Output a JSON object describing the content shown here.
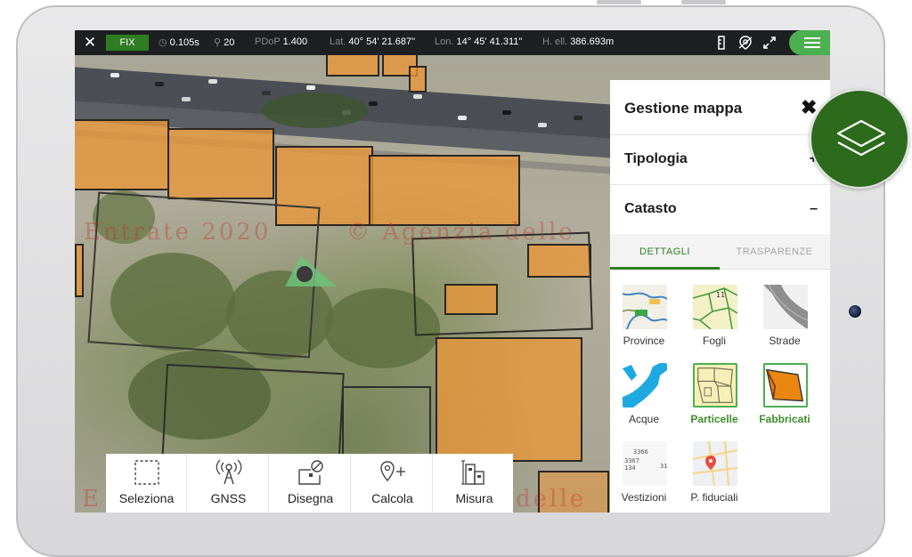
{
  "statusbar": {
    "fix_label": "FIX",
    "latency": "0.105s",
    "satellites": "20",
    "pdop_label": "PDoP",
    "pdop_value": "1.400",
    "lat_label": "Lat.",
    "lat_value": "40° 54' 21.687\"",
    "lon_label": "Lon.",
    "lon_value": "14° 45' 41.311\"",
    "hell_label": "H. ell.",
    "hell_value": "386.693m"
  },
  "map": {
    "watermark_1": "Entrate 2020",
    "watermark_2": "© Agenzia delle",
    "watermark_3": "E",
    "watermark_4": "delle"
  },
  "panel": {
    "title": "Gestione mappa",
    "close_icon": "close-icon",
    "sections": [
      {
        "label": "Tipologia",
        "sign": "+"
      },
      {
        "label": "Catasto",
        "sign": "–"
      }
    ],
    "tabs": [
      {
        "label": "DETTAGLI"
      },
      {
        "label": "TRASPARENZE"
      }
    ],
    "layers": [
      {
        "label": "Province"
      },
      {
        "label": "Fogli"
      },
      {
        "label": "Strade"
      },
      {
        "label": "Acque"
      },
      {
        "label": "Particelle"
      },
      {
        "label": "Fabbricati"
      },
      {
        "label": "Vestizioni"
      },
      {
        "label": "P. fiduciali"
      }
    ],
    "fogli_thumb_number": "11",
    "vestizioni_thumb_text": [
      "3366",
      "3367",
      "134",
      "31"
    ]
  },
  "toolbar": {
    "tools": [
      {
        "label": "Seleziona"
      },
      {
        "label": "GNSS"
      },
      {
        "label": "Disegna"
      },
      {
        "label": "Calcola"
      },
      {
        "label": "Misura"
      }
    ]
  },
  "colors": {
    "accent_green": "#4caf50",
    "dark_green": "#2e7d22",
    "building_orange": "#e99637"
  }
}
